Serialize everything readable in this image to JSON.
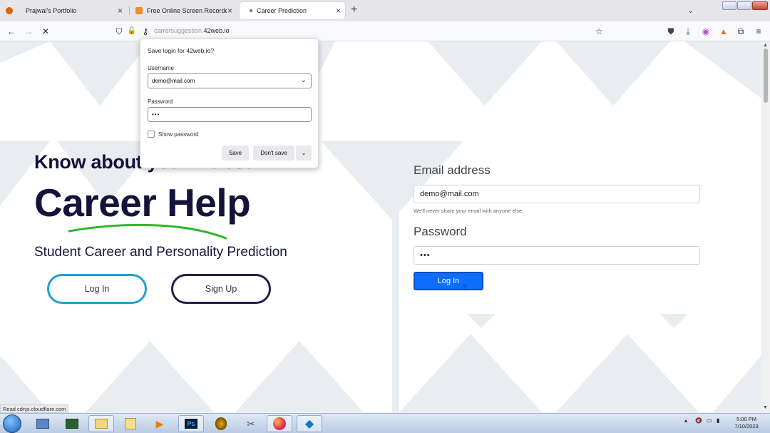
{
  "browser": {
    "tabs": [
      {
        "title": "Prajwal's Portfolio",
        "active": false
      },
      {
        "title": "Free Online Screen Recorder &",
        "active": false
      },
      {
        "title": "Career Prediction",
        "active": true
      }
    ],
    "address": {
      "prefix": "carrersuggestion.",
      "domain": "42web.io"
    },
    "status_text": "Read cdnjs.cloudflare.com"
  },
  "save_login_popup": {
    "title": "Save login for 42web.io?",
    "username_label": "Username",
    "username_value": "demo@mail.com",
    "password_label": "Password",
    "password_value": "•••",
    "show_password_label": "Show password",
    "save_label": "Save",
    "dont_save_label": "Don't save"
  },
  "hero": {
    "headline": "Know about your intrest...",
    "title": "Career Help",
    "subtitle": "Student Career and Personality Prediction",
    "login_label": "Log In",
    "signup_label": "Sign Up"
  },
  "login_form": {
    "email_label": "Email address",
    "email_value": "demo@mail.com",
    "email_help": "We'll never share your email with anyone else.",
    "password_label": "Password",
    "password_value": "•••",
    "submit_label": "Log In"
  },
  "taskbar": {
    "time": "5:00 PM",
    "date": "7/10/2023",
    "apps": [
      "explorer",
      "computer",
      "terminal",
      "files",
      "folder",
      "media",
      "photoshop",
      "fl-studio",
      "tool",
      "firefox",
      "vscode"
    ]
  },
  "colors": {
    "brand_dark": "#14133b",
    "accent_blue": "#0d6efd",
    "login_pill_border": "#1ea0d8",
    "underline_green": "#2eb82e"
  }
}
